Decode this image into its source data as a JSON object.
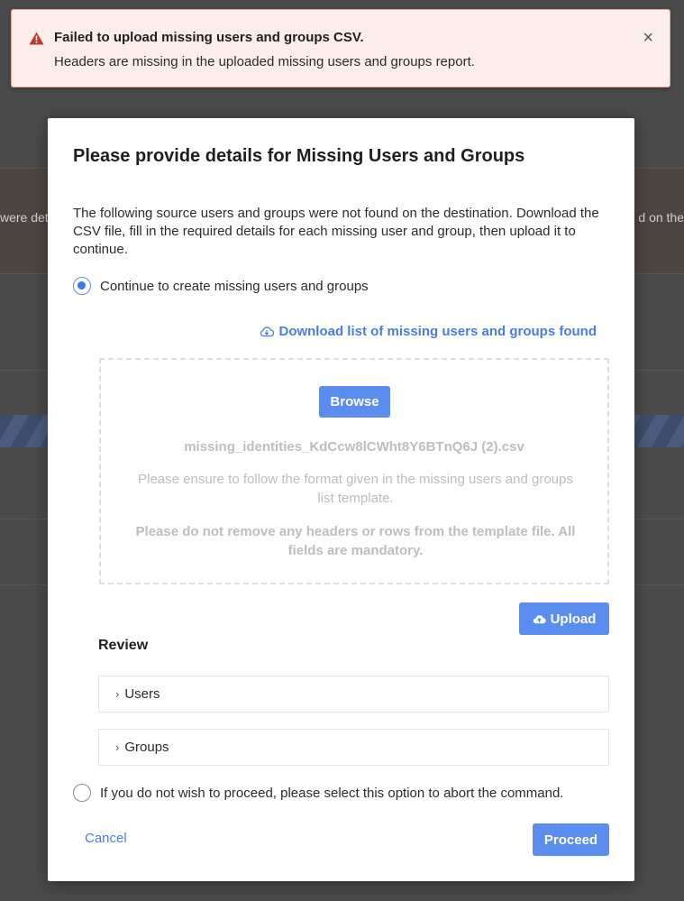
{
  "background": {
    "strip_left_text": "were det",
    "strip_right_text": "d on the"
  },
  "toast": {
    "title": "Failed to upload missing users and groups CSV.",
    "message": "Headers are missing in the uploaded missing users and groups report.",
    "close_symbol": "×",
    "icon": "warning-triangle-icon",
    "color": "#c0392b"
  },
  "modal": {
    "title": "Please provide details for Missing Users and Groups",
    "description": "The following source users and groups were not found on the destination. Download the CSV file, fill in the required details for each missing user and group, then upload it to continue.",
    "option_continue": {
      "label": "Continue to create missing users and groups",
      "selected": true
    },
    "download_link": "Download list of missing users and groups found",
    "dropzone": {
      "browse_label": "Browse",
      "filename": "missing_identities_KdCcw8lCWht8Y6BTnQ6J (2).csv",
      "note": "Please ensure to follow the format given in the missing users and groups list template.",
      "warning": "Please do not remove any headers or rows from the template file. All fields are mandatory."
    },
    "upload_label": "Upload",
    "review": {
      "title": "Review",
      "sections": [
        {
          "label": "Users",
          "chevron": "›"
        },
        {
          "label": "Groups",
          "chevron": "›"
        }
      ]
    },
    "option_abort": {
      "label": "If you do not wish to proceed, please select this option to abort the command.",
      "selected": false
    },
    "cancel_label": "Cancel",
    "proceed_label": "Proceed"
  },
  "colors": {
    "primary": "#5b8def",
    "link": "#4a7de0",
    "error": "#c0392b"
  }
}
